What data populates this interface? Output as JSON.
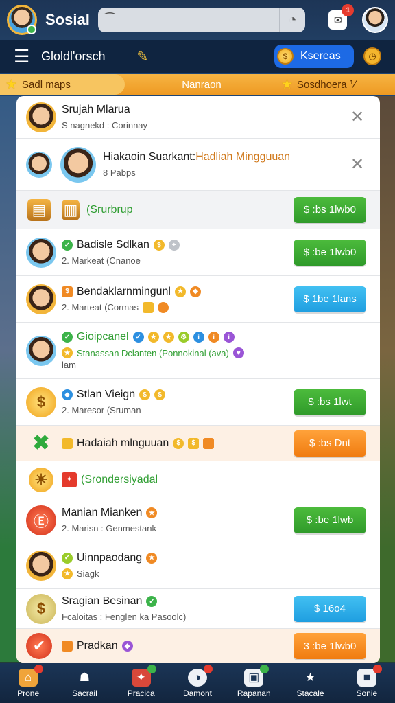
{
  "header": {
    "app_title": "Sosial",
    "search": {
      "value": "",
      "placeholder": ""
    },
    "inbox_count": "1"
  },
  "navbar": {
    "title": "Gloldl'orsch",
    "coin_button_label": "Ksereas"
  },
  "tabs": [
    {
      "label": "Sadl maps"
    },
    {
      "label": "Nanraon"
    },
    {
      "label": "Sosdhoera ⅟"
    }
  ],
  "rows": [
    {
      "title": "Srujah Mlarua",
      "subtitle": "S nagnekd : Corinnay",
      "action": "close"
    },
    {
      "title_main": "Hiakaoin Suarkant: ",
      "title_accent": "Hadliah Mingguuan",
      "subtitle": "8 Pabps",
      "action": "close"
    },
    {
      "title": "(Srurbrup",
      "button": "$ :bs 1lwb0"
    },
    {
      "title": "Badisle Sdlkan",
      "subtitle": "2. Markeat (Cnanoe",
      "button": "$ :be 1lwb0"
    },
    {
      "title": "Bendaklarnmingunl",
      "subtitle": "2. Marteat (Cormas",
      "button": "$ 1be 1lans"
    },
    {
      "title": "Gioipcanel",
      "subtitle": "Stanassan   Dclanten   (Ponnokinal (ava)",
      "subtitle2": "lam"
    },
    {
      "title": "Stlan Vieign",
      "subtitle": "2. Maresor (Sruman",
      "button": "$ :bs 1lwt"
    },
    {
      "title": "Hadaiah mlnguuan",
      "button": "$ :bs Dnt"
    },
    {
      "title": "(Srondersiyadal"
    },
    {
      "title": "Manian Mianken",
      "subtitle": "2. Marisn : Genmestank",
      "button": "$ :be 1lwb"
    },
    {
      "title": "Uinnpaodang",
      "subtitle": "Siagk"
    },
    {
      "title": "Sragian Besinan",
      "subtitle": "Fcaloitas : Fenglen ka Pasoolc)",
      "button": "$ 16o4"
    },
    {
      "title": "Pradkan",
      "button": "3 :be 1lwb0"
    }
  ],
  "bottom_nav": [
    {
      "label": "Prone",
      "icon": "home-icon"
    },
    {
      "label": "Sacrail",
      "icon": "city-icon"
    },
    {
      "label": "Pracica",
      "icon": "gift-icon"
    },
    {
      "label": "Damont",
      "icon": "globe-icon"
    },
    {
      "label": "Rapanan",
      "icon": "box-icon"
    },
    {
      "label": "Stacale",
      "icon": "shield-icon"
    },
    {
      "label": "Sonie",
      "icon": "cube-icon"
    }
  ],
  "colors": {
    "accent_green": "#2f9a2a",
    "accent_blue": "#1f9ee0",
    "accent_orange": "#f07c10",
    "header_bg": "#1d3556",
    "tab_bg": "#f6b443"
  }
}
